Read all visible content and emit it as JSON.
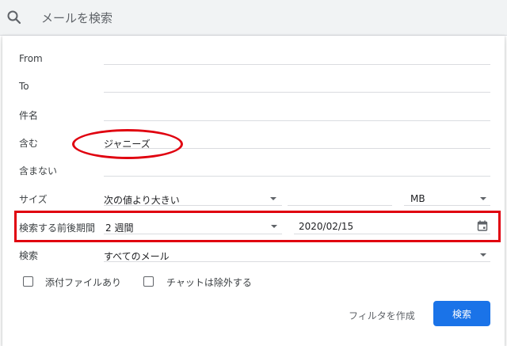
{
  "search": {
    "placeholder": "メールを検索"
  },
  "fields": {
    "from": {
      "label": "From",
      "value": ""
    },
    "to": {
      "label": "To",
      "value": ""
    },
    "subject": {
      "label": "件名",
      "value": ""
    },
    "has_words": {
      "label": "含む",
      "value": "ジャニーズ"
    },
    "doesnt_have": {
      "label": "含まない",
      "value": ""
    }
  },
  "size": {
    "label": "サイズ",
    "comparator": "次の値より大きい",
    "amount": "",
    "unit": "MB"
  },
  "date_within": {
    "label": "検索する前後期間",
    "period": "2 週間",
    "date": "2020/02/15"
  },
  "search_scope": {
    "label": "検索",
    "value": "すべてのメール"
  },
  "checkboxes": {
    "has_attachment": {
      "label": "添付ファイルあり",
      "checked": false
    },
    "exclude_chats": {
      "label": "チャットは除外する",
      "checked": false
    }
  },
  "actions": {
    "create_filter": "フィルタを作成",
    "search": "検索"
  },
  "colors": {
    "accent": "#1a73e8",
    "annotation": "#e0000f",
    "topbar_bg": "#f1f3f4"
  }
}
